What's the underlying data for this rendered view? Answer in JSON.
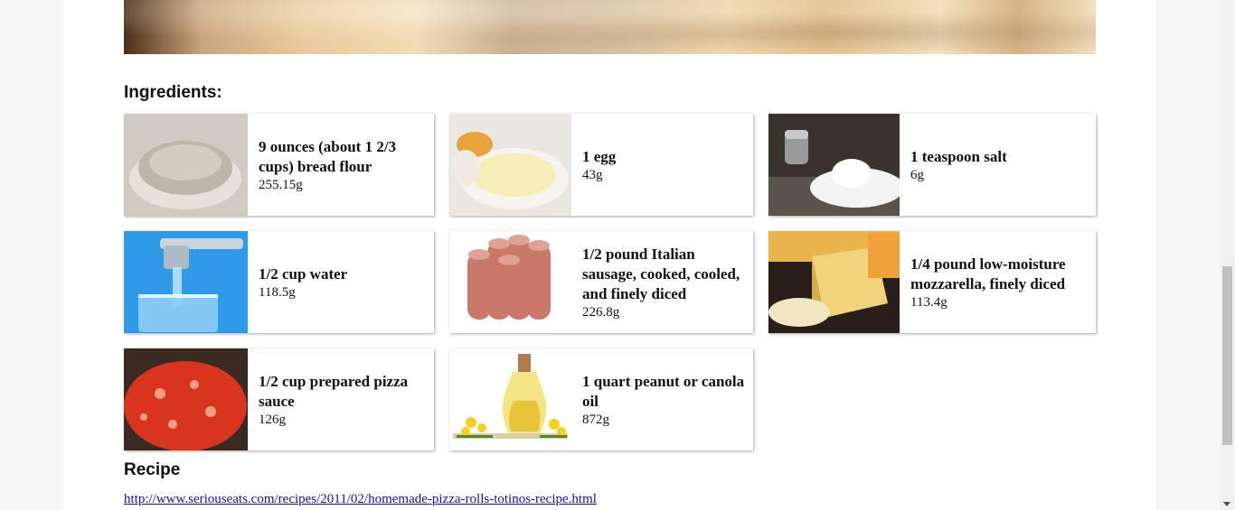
{
  "ingredients_heading": "Ingredients:",
  "recipe_heading": "Recipe",
  "recipe_link": "http://www.seriouseats.com/recipes/2011/02/homemade-pizza-rolls-totinos-recipe.html",
  "ingredients": [
    {
      "name": "9 ounces (about 1 2/3 cups) bread flour",
      "weight": "255.15g",
      "icon": "flour-icon"
    },
    {
      "name": "1 egg",
      "weight": "43g",
      "icon": "egg-icon"
    },
    {
      "name": "1 teaspoon salt",
      "weight": "6g",
      "icon": "salt-icon"
    },
    {
      "name": "1/2 cup water",
      "weight": "118.5g",
      "icon": "water-icon"
    },
    {
      "name": "1/2 pound Italian sausage, cooked, cooled, and finely diced",
      "weight": "226.8g",
      "icon": "sausage-icon"
    },
    {
      "name": "1/4 pound low-moisture mozzarella, finely diced",
      "weight": "113.4g",
      "icon": "cheese-icon"
    },
    {
      "name": "1/2 cup prepared pizza sauce",
      "weight": "126g",
      "icon": "sauce-icon"
    },
    {
      "name": "1 quart peanut or canola oil",
      "weight": "872g",
      "icon": "oil-icon"
    }
  ]
}
